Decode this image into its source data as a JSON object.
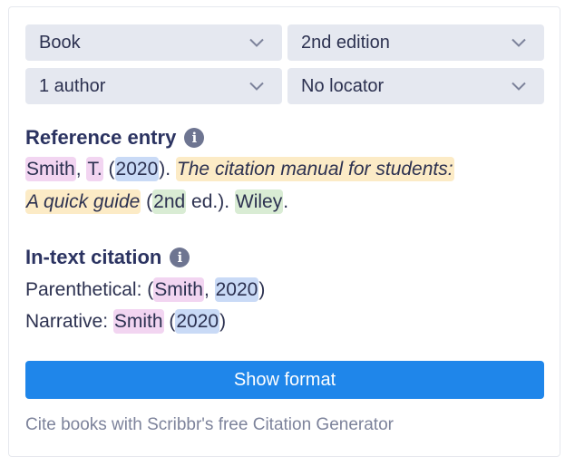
{
  "selects": {
    "source_type": "Book",
    "edition": "2nd edition",
    "authors": "1 author",
    "locator": "No locator"
  },
  "icons": {
    "dropdown": "chevron-down-icon",
    "info": "info-icon"
  },
  "reference": {
    "heading": "Reference entry",
    "info_glyph": "i",
    "author_last": "Smith",
    "sep1": ", ",
    "author_initial": "T.",
    "open_year": " (",
    "year": "2020",
    "close_year": "). ",
    "title_line1": "The citation manual for students:",
    "title_line2": "A quick guide",
    "open_ed": " (",
    "edition": "2nd",
    "close_ed": " ed.). ",
    "publisher": "Wiley",
    "end": "."
  },
  "in_text": {
    "heading": "In-text citation",
    "info_glyph": "i",
    "parenthetical_label": "Parenthetical: (",
    "parenthetical_author": "Smith",
    "parenthetical_sep": ", ",
    "parenthetical_year": "2020",
    "parenthetical_end": ")",
    "narrative_label": "Narrative: ",
    "narrative_author": "Smith",
    "narrative_open": " (",
    "narrative_year": "2020",
    "narrative_end": ")"
  },
  "button": {
    "label": "Show format"
  },
  "footer": {
    "text": "Cite books with Scribbr's free Citation Generator"
  },
  "colors": {
    "accent": "#1f86ea",
    "select_bg": "#e5e8f0",
    "author_highlight": "#f2d5f1",
    "date_highlight": "#c9daf6",
    "title_highlight": "#fcebc6",
    "edition_publisher_highlight": "#d9ecd4"
  }
}
